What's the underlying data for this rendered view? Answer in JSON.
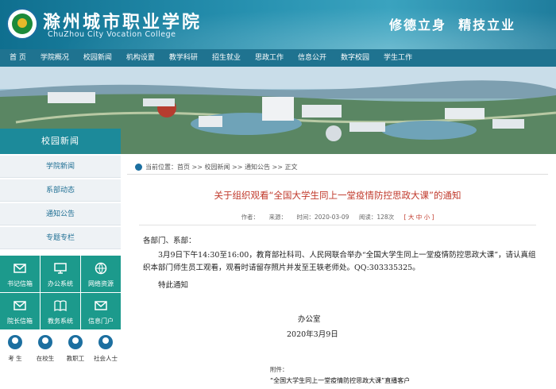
{
  "header": {
    "title_cn": "滁州城市职业学院",
    "title_en": "ChuZhou City Vocation College",
    "motto": "修德立身  精技立业"
  },
  "nav": {
    "items": [
      "首 页",
      "学院概况",
      "校园新闻",
      "机构设置",
      "教学科研",
      "招生就业",
      "思政工作",
      "信息公开",
      "数字校园",
      "学生工作"
    ]
  },
  "sidebar": {
    "title": "校园新闻",
    "items": [
      "学院新闻",
      "系部动态",
      "通知公告",
      "专题专栏"
    ],
    "tiles": [
      {
        "label": "书记信箱",
        "icon": "mail-icon"
      },
      {
        "label": "办公系统",
        "icon": "monitor-icon"
      },
      {
        "label": "网络资源",
        "icon": "globe-icon"
      },
      {
        "label": "院长信箱",
        "icon": "mail-icon"
      },
      {
        "label": "教务系统",
        "icon": "book-icon"
      },
      {
        "label": "信息门户",
        "icon": "mail-icon"
      }
    ],
    "people": [
      "考 生",
      "在校生",
      "教职工",
      "社会人士"
    ]
  },
  "breadcrumb": {
    "text": "当前位置：首页 >> 校园新闻 >> 通知公告 >> 正文"
  },
  "article": {
    "title": "关于组织观看“全国大学生同上一堂疫情防控思政大课”的通知",
    "author_label": "作者：",
    "source_label": "来源：",
    "time": "时间：2020-03-09",
    "views": "阅读：128次",
    "font_size": "[ 大 中 小 ]",
    "greeting": "各部门、系部：",
    "paragraph": "3月9日下午14:30至16:00，教育部社科司、人民网联合举办“全国大学生同上一堂疫情防控思政大课”，请认真组织本部门师生员工观看，观看时请留存照片并发至王轶老师处。QQ:303335325。",
    "notice": "特此通知",
    "signature": "办公室",
    "date": "2020年3月9日",
    "attachment_label": "附件：",
    "attachment_link": "“全国大学生同上一堂疫情防控思政大课”直播客户"
  },
  "colors": {
    "header_blue": "#1f7390",
    "teal_tile": "#1c9a8c",
    "title_red": "#c0392b"
  }
}
